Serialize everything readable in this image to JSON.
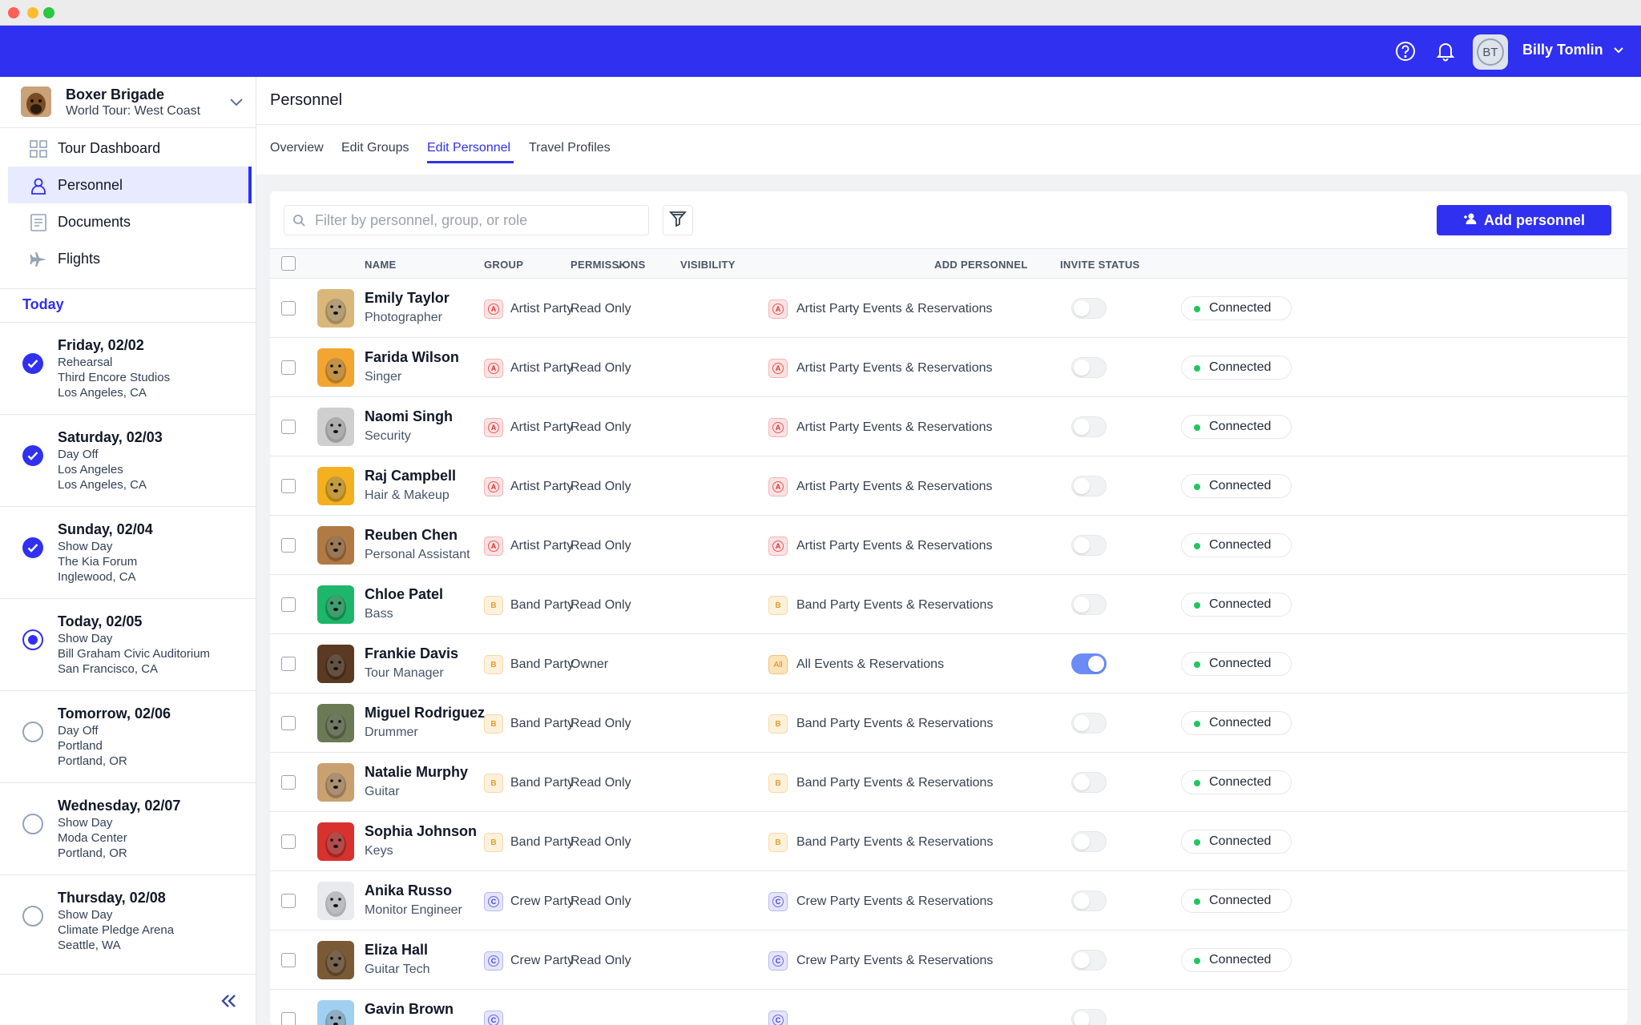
{
  "user": {
    "initials": "BT",
    "name": "Billy Tomlin"
  },
  "tour": {
    "name": "Boxer Brigade",
    "subtitle": "World Tour: West Coast"
  },
  "nav": [
    {
      "label": "Tour Dashboard",
      "icon": "grid-icon"
    },
    {
      "label": "Personnel",
      "icon": "person-icon",
      "active": true
    },
    {
      "label": "Documents",
      "icon": "document-icon"
    },
    {
      "label": "Flights",
      "icon": "plane-icon"
    }
  ],
  "today_label": "Today",
  "days": [
    {
      "title": "Friday, 02/02",
      "type": "Rehearsal",
      "venue": "Third Encore Studios",
      "city": "Los Angeles, CA",
      "state": "done"
    },
    {
      "title": "Saturday, 02/03",
      "type": "Day Off",
      "venue": "Los Angeles",
      "city": "Los Angeles, CA",
      "state": "done"
    },
    {
      "title": "Sunday, 02/04",
      "type": "Show Day",
      "venue": "The Kia Forum",
      "city": "Inglewood, CA",
      "state": "done"
    },
    {
      "title": "Today, 02/05",
      "type": "Show Day",
      "venue": "Bill Graham Civic Auditorium",
      "city": "San Francisco, CA",
      "state": "current"
    },
    {
      "title": "Tomorrow, 02/06",
      "type": "Day Off",
      "venue": "Portland",
      "city": "Portland, OR",
      "state": "future"
    },
    {
      "title": "Wednesday, 02/07",
      "type": "Show Day",
      "venue": "Moda Center",
      "city": "Portland, OR",
      "state": "future"
    },
    {
      "title": "Thursday, 02/08",
      "type": "Show Day",
      "venue": "Climate Pledge Arena",
      "city": "Seattle, WA",
      "state": "future"
    }
  ],
  "page": {
    "title": "Personnel",
    "tabs": [
      "Overview",
      "Edit Groups",
      "Edit Personnel",
      "Travel Profiles"
    ],
    "active_tab": "Edit Personnel"
  },
  "search": {
    "placeholder": "Filter by personnel, group, or role",
    "value": ""
  },
  "add_button": "Add personnel",
  "columns": [
    "NAME",
    "GROUP",
    "PERMISSIONS",
    "VISIBILITY",
    "ADD PERSONNEL",
    "INVITE STATUS"
  ],
  "rows": [
    {
      "name": "Emily Taylor",
      "role": "Photographer",
      "group_badge": "A",
      "group": "Artist Party",
      "permission": "Read Only",
      "vis_badge": "A",
      "visibility": "Artist Party Events & Reservations",
      "add_personnel": false,
      "status": "Connected",
      "photo_color": "#d9b77a"
    },
    {
      "name": "Farida Wilson",
      "role": "Singer",
      "group_badge": "A",
      "group": "Artist Party",
      "permission": "Read Only",
      "vis_badge": "A",
      "visibility": "Artist Party Events & Reservations",
      "add_personnel": false,
      "status": "Connected",
      "photo_color": "#f2a530"
    },
    {
      "name": "Naomi Singh",
      "role": "Security",
      "group_badge": "A",
      "group": "Artist Party",
      "permission": "Read Only",
      "vis_badge": "A",
      "visibility": "Artist Party Events & Reservations",
      "add_personnel": false,
      "status": "Connected",
      "photo_color": "#cfcfcf"
    },
    {
      "name": "Raj Campbell",
      "role": "Hair & Makeup",
      "group_badge": "A",
      "group": "Artist Party",
      "permission": "Read Only",
      "vis_badge": "A",
      "visibility": "Artist Party Events & Reservations",
      "add_personnel": false,
      "status": "Connected",
      "photo_color": "#f4b020"
    },
    {
      "name": "Reuben Chen",
      "role": "Personal Assistant",
      "group_badge": "A",
      "group": "Artist Party",
      "permission": "Read Only",
      "vis_badge": "A",
      "visibility": "Artist Party Events & Reservations",
      "add_personnel": false,
      "status": "Connected",
      "photo_color": "#b07a44"
    },
    {
      "name": "Chloe Patel",
      "role": "Bass",
      "group_badge": "B",
      "group": "Band Party",
      "permission": "Read Only",
      "vis_badge": "B",
      "visibility": "Band Party Events & Reservations",
      "add_personnel": false,
      "status": "Connected",
      "photo_color": "#1db66a"
    },
    {
      "name": "Frankie Davis",
      "role": "Tour Manager",
      "group_badge": "B",
      "group": "Band Party",
      "permission": "Owner",
      "vis_badge": "All",
      "visibility": "All Events & Reservations",
      "add_personnel": true,
      "status": "Connected",
      "photo_color": "#5a3a22"
    },
    {
      "name": "Miguel Rodriguez",
      "role": "Drummer",
      "group_badge": "B",
      "group": "Band Party",
      "permission": "Read Only",
      "vis_badge": "B",
      "visibility": "Band Party Events & Reservations",
      "add_personnel": false,
      "status": "Connected",
      "photo_color": "#6b7a55"
    },
    {
      "name": "Natalie Murphy",
      "role": "Guitar",
      "group_badge": "B",
      "group": "Band Party",
      "permission": "Read Only",
      "vis_badge": "B",
      "visibility": "Band Party Events & Reservations",
      "add_personnel": false,
      "status": "Connected",
      "photo_color": "#c9a070"
    },
    {
      "name": "Sophia Johnson",
      "role": "Keys",
      "group_badge": "B",
      "group": "Band Party",
      "permission": "Read Only",
      "vis_badge": "B",
      "visibility": "Band Party Events & Reservations",
      "add_personnel": false,
      "status": "Connected",
      "photo_color": "#d8322f"
    },
    {
      "name": "Anika Russo",
      "role": "Monitor Engineer",
      "group_badge": "C",
      "group": "Crew Party",
      "permission": "Read Only",
      "vis_badge": "C",
      "visibility": "Crew Party Events & Reservations",
      "add_personnel": false,
      "status": "Connected",
      "photo_color": "#e8eaee"
    },
    {
      "name": "Eliza Hall",
      "role": "Guitar Tech",
      "group_badge": "C",
      "group": "Crew Party",
      "permission": "Read Only",
      "vis_badge": "C",
      "visibility": "Crew Party Events & Reservations",
      "add_personnel": false,
      "status": "Connected",
      "photo_color": "#7a5a36"
    },
    {
      "name": "Gavin Brown",
      "role": "",
      "group_badge": "C",
      "group": "",
      "permission": "",
      "vis_badge": "C",
      "visibility": "",
      "add_personnel": false,
      "status": "",
      "photo_color": "#9fd0f0"
    }
  ],
  "colors": {
    "brand": "#3030f0",
    "connected": "#22c55e"
  }
}
